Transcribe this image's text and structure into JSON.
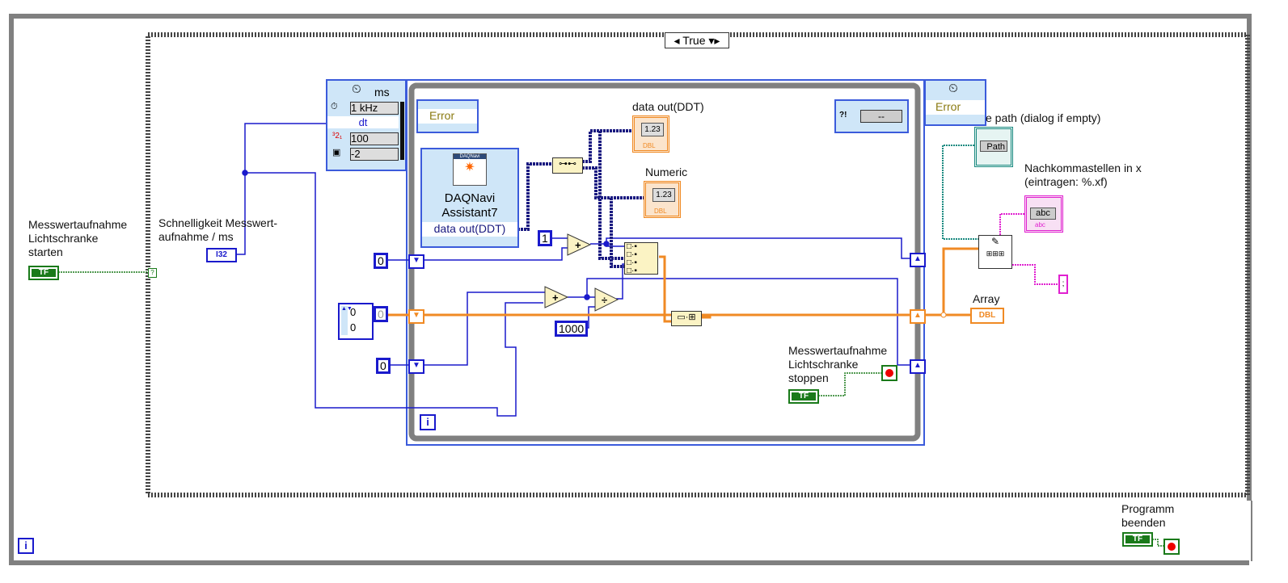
{
  "case_selector": {
    "value": "True"
  },
  "controls": {
    "start": {
      "label": "Messwertaufnahme\nLichtschranke\nstarten",
      "type": "TF"
    },
    "speed": {
      "label": "Schnelligkeit Messwert-\naufnahme / ms",
      "type": "I32"
    },
    "stop_inner": {
      "label": "Messwertaufnahme\nLichtschranke\nstoppen",
      "type": "TF"
    },
    "stop_program": {
      "label": "Programm\nbeenden",
      "type": "TF"
    },
    "file_path": {
      "label": "e path (dialog if empty)",
      "value": "Path"
    },
    "format": {
      "label": "Nachkommastellen in x\n(eintragen: %.xf)",
      "value": "abc",
      "type": "abc"
    }
  },
  "timed_loop": {
    "unit": "ms",
    "source": "1 kHz",
    "dt": "dt",
    "priority": "100",
    "processor": "-2",
    "error": "Error",
    "right_error": "Error",
    "status": "--",
    "status_prefix": "?!"
  },
  "daq": {
    "title": "DAQNavi\nAssistant7",
    "logo": "DAQNavi",
    "output": "data out(DDT)"
  },
  "indicators": {
    "data_out": {
      "label": "data out(DDT)",
      "value": "1.23",
      "type": "DBL"
    },
    "numeric": {
      "label": "Numeric",
      "value": "1.23",
      "type": "DBL"
    },
    "array": {
      "label": "Array",
      "type": "DBL"
    }
  },
  "constants": {
    "one": "1",
    "zero_a": "0",
    "zero_b": "0",
    "thousand": "1000",
    "array_vals": [
      "0",
      "0"
    ],
    "array_index": "0",
    "delimiter": ";"
  },
  "functions": {
    "add": "+",
    "divide": "÷"
  },
  "iteration": "i",
  "colors": {
    "numeric_wire": "#1a1acc",
    "double_wire": "#f08a24",
    "boolean_wire": "#1a7a1a",
    "path_wire": "#1a8a80",
    "string_wire": "#e020d0",
    "dynamic_wire": "#1a1a80",
    "loop_border": "#808080"
  }
}
